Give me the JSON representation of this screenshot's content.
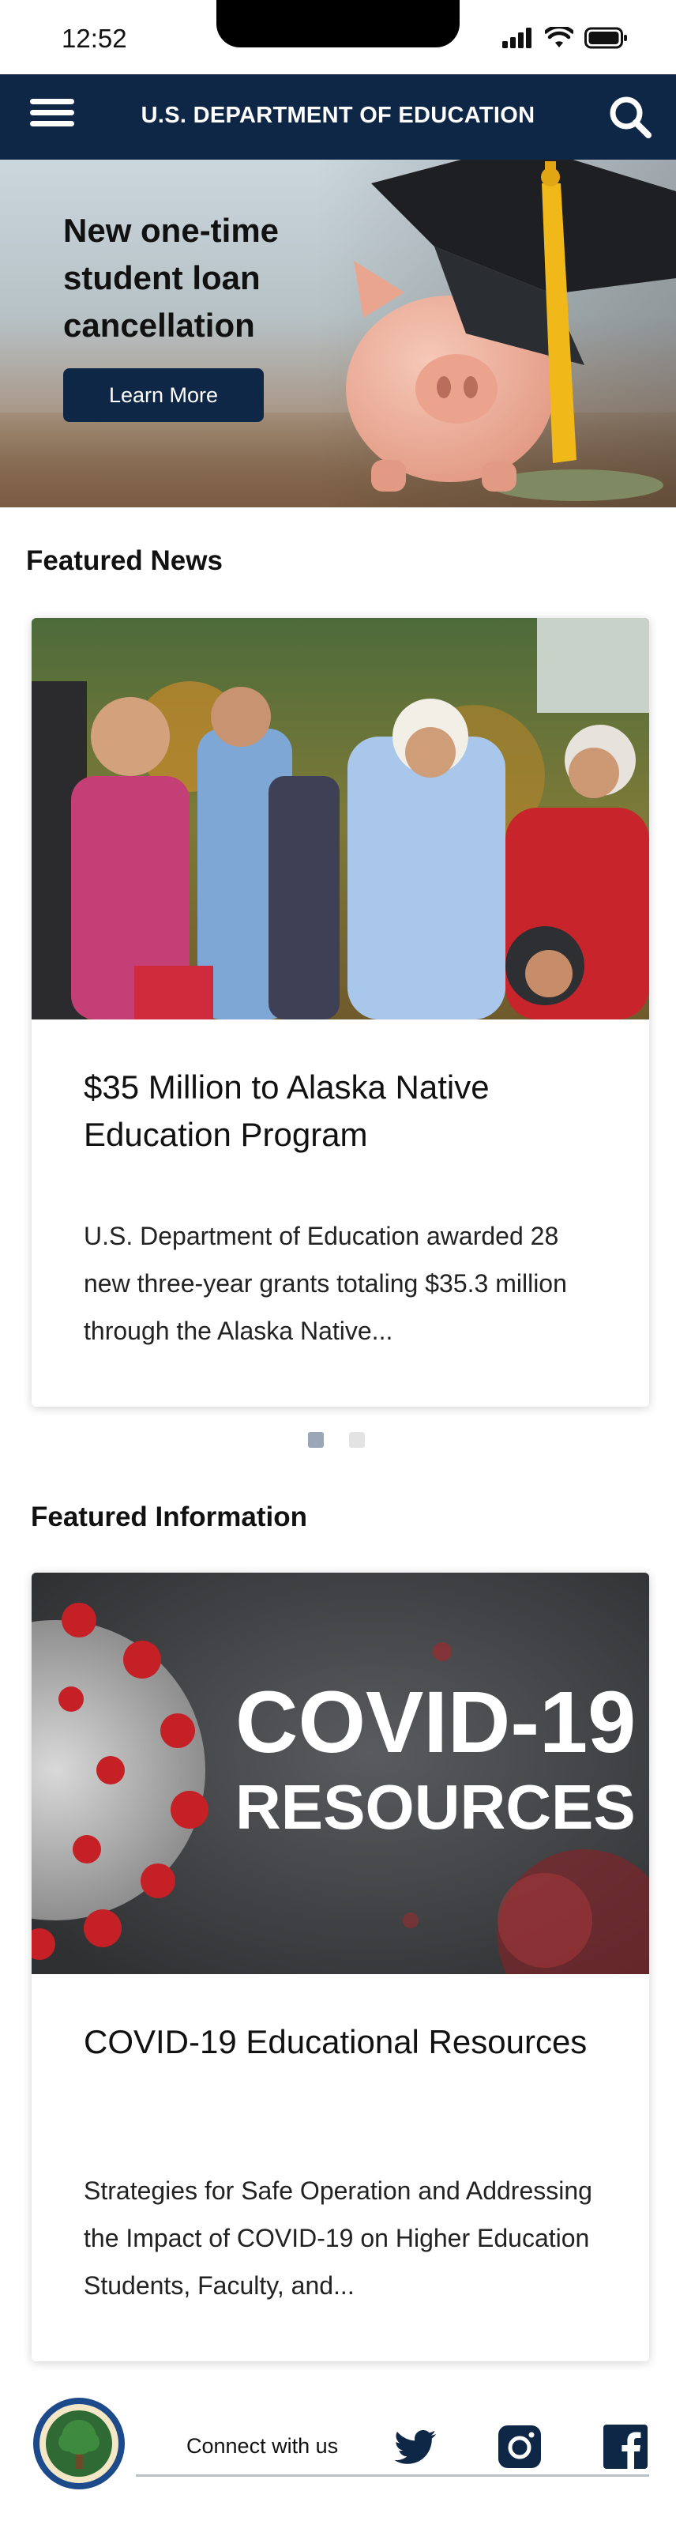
{
  "status_bar": {
    "time": "12:52",
    "icons": [
      "signal-icon",
      "wifi-icon",
      "battery-icon"
    ]
  },
  "header": {
    "title": "U.S. DEPARTMENT OF EDUCATION",
    "menu_icon": "hamburger-menu-icon",
    "search_icon": "search-icon",
    "background_color": "#0f2747"
  },
  "hero": {
    "headline": "New one-time student loan cancellation",
    "button_label": "Learn More"
  },
  "featured_news": {
    "heading": "Featured News",
    "cards": [
      {
        "title": "$35 Million to Alaska Native Education Program",
        "description": "U.S. Department of Education awarded 28 new three-year grants totaling $35.3 million through the Alaska Native..."
      }
    ],
    "carousel": {
      "pages": 2,
      "active_index": 0
    }
  },
  "featured_information": {
    "heading": "Featured Information",
    "image_text_line1": "COVID-19",
    "image_text_line2": "RESOURCES",
    "title": "COVID-19 Educational Resources",
    "description": "Strategies for Safe Operation and Addressing the Impact of COVID-19 on Higher Education Students, Faculty, and..."
  },
  "footer": {
    "connect_label": "Connect with us",
    "seal_icon": "department-seal-icon",
    "social_icons": [
      "twitter-icon",
      "instagram-icon",
      "facebook-icon"
    ]
  },
  "colors": {
    "brand_navy": "#0f2747",
    "active_dot": "#9aa7b8",
    "inactive_dot": "#e3e3e3"
  }
}
